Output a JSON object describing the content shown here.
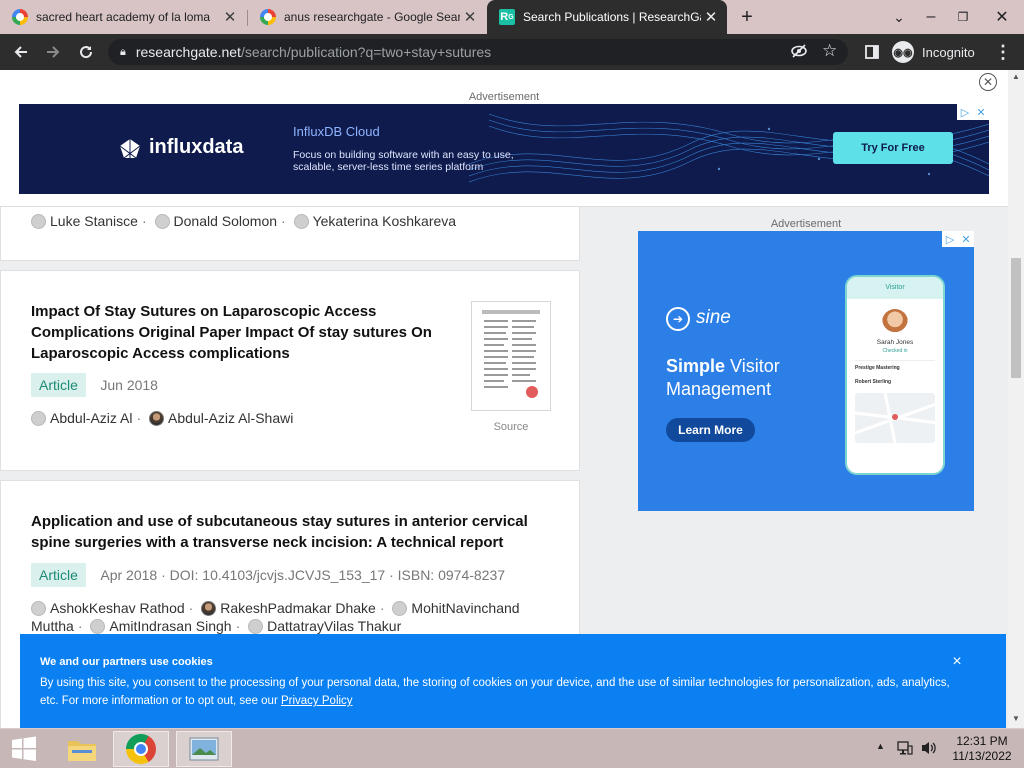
{
  "browser": {
    "tabs": [
      {
        "title": "sacred heart academy of la loma",
        "favicon": "google-icon"
      },
      {
        "title": "anus researchgate - Google Sear",
        "favicon": "google-icon"
      },
      {
        "title": "Search Publications | ResearchGa",
        "favicon": "researchgate-icon"
      }
    ],
    "new_tab": "+",
    "url_host": "researchgate.net",
    "url_path": "/search/publication?q=two+stay+sutures",
    "incognito_label": "Incognito"
  },
  "page": {
    "ad_label_top": "Advertisement",
    "top_ad": {
      "brand": "influxdata",
      "headline": "InfluxDB Cloud",
      "body": "Focus on building software with an easy to use, scalable, server-less time series platform",
      "cta": "Try For Free"
    },
    "ad_label_side": "Advertisement",
    "side_ad": {
      "brand": "sine",
      "headline_bold": "Simple",
      "headline_rest": "Visitor Management",
      "cta": "Learn More",
      "phone_header": "Visitor",
      "phone_name": "Sarah Jones",
      "phone_status": "Checked in",
      "phone_item1": "Prestige Mastering",
      "phone_item2": "Robert Sterling"
    },
    "results": [
      {
        "authors": [
          "Luke Stanisce",
          "Donald Solomon",
          "Yekaterina Koshkareva"
        ]
      },
      {
        "title": "Impact Of Stay Sutures on Laparoscopic Access Complications Original Paper Impact Of stay sutures On Laparoscopic Access complications",
        "type": "Article",
        "meta": "Jun 2018",
        "authors": [
          "Abdul-Aziz Al",
          "Abdul-Aziz Al-Shawi"
        ],
        "source_label": "Source"
      },
      {
        "title": "Application and use of subcutaneous stay sutures in anterior cervical spine surgeries with a transverse neck incision: A technical report",
        "type": "Article",
        "meta": "Apr 2018 · DOI: 10.4103/jcvjs.JCVJS_153_17 · ISBN: 0974-8237",
        "authors": [
          "AshokKeshav Rathod",
          "RakeshPadmakar Dhake",
          "MohitNavinchand Muttha",
          "AmitIndrasan Singh",
          "DattatrayVilas Thakur"
        ]
      }
    ],
    "cookie": {
      "heading": "We and our partners use cookies",
      "body": "By using this site, you consent to the processing of your personal data, the storing of cookies on your device, and the use of similar technologies for personalization, ads, analytics, etc. For more information or to opt out, see our",
      "link": "Privacy Policy",
      "close": "×"
    }
  },
  "taskbar": {
    "time": "12:31 PM",
    "date": "11/13/2022"
  },
  "colors": {
    "tab_bar": "#d8c4c5",
    "toolbar": "#2d2d2d",
    "cookie_banner": "#0a80f2",
    "badge_bg": "#daf0ec",
    "badge_text": "#1c8b76"
  }
}
